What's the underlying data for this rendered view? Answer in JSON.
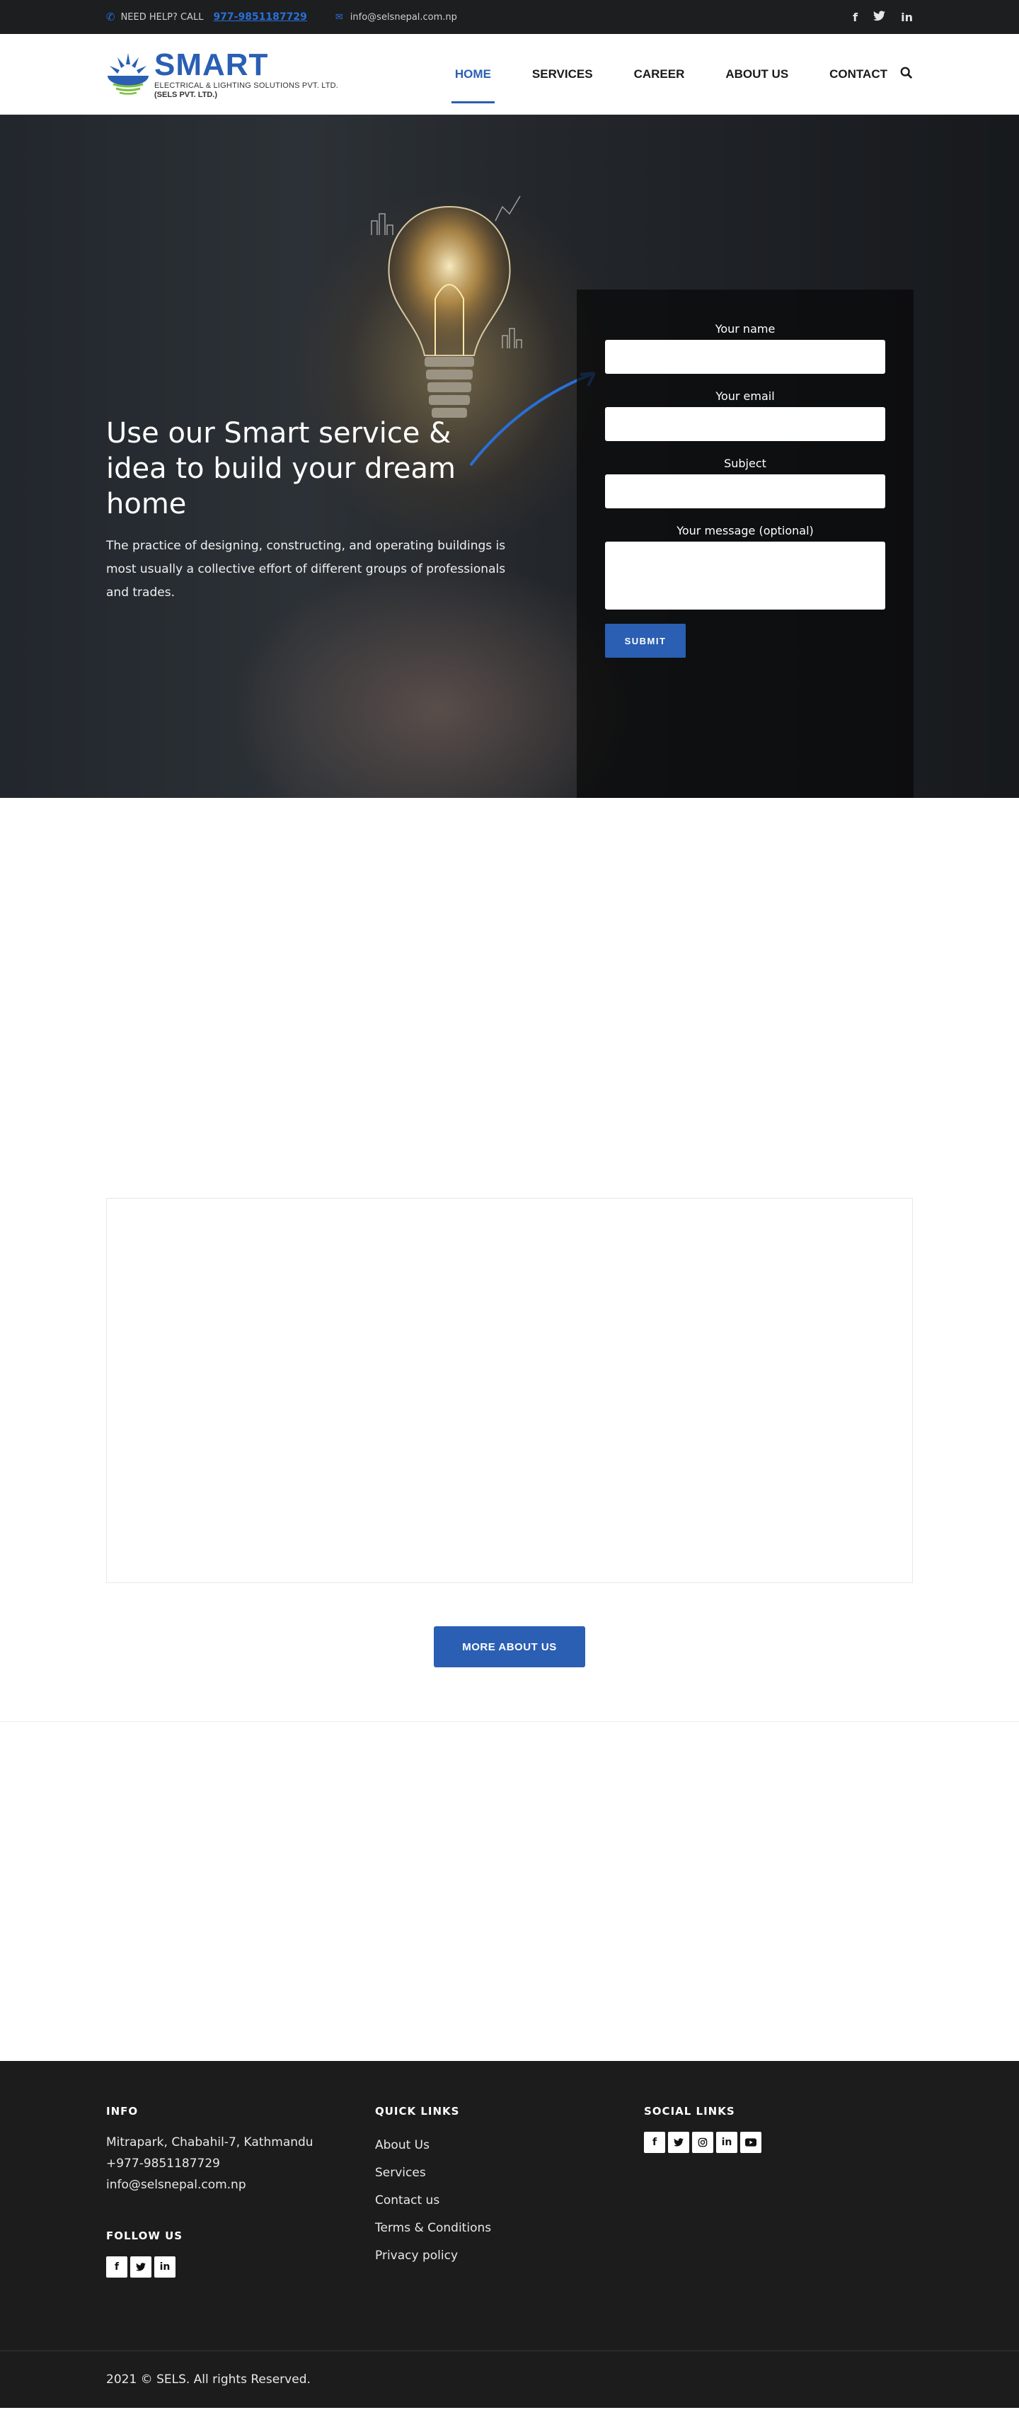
{
  "topbar": {
    "help_text": "NEED HELP? CALL",
    "phone": "977-9851187729",
    "email": "info@selsnepal.com.np",
    "socials": [
      "facebook-icon",
      "twitter-icon",
      "linkedin-icon"
    ]
  },
  "logo": {
    "brand": "SMART",
    "subtitle": "ELECTRICAL & LIGHTING SOLUTIONS PVT. LTD.",
    "subtitle2": "(SELS PVT. LTD.)"
  },
  "nav": {
    "items": [
      {
        "label": "HOME",
        "active": true
      },
      {
        "label": "SERVICES",
        "active": false
      },
      {
        "label": "CAREER",
        "active": false
      },
      {
        "label": "ABOUT US",
        "active": false
      },
      {
        "label": "CONTACT",
        "active": false
      }
    ]
  },
  "hero": {
    "title": "Use our Smart service & idea to build your dream home",
    "description": "The practice of designing, constructing, and operating buildings is most usually a collective effort of different groups of professionals and trades."
  },
  "form": {
    "name_label": "Your name",
    "email_label": "Your email",
    "subject_label": "Subject",
    "message_label": "Your message (optional)",
    "submit_label": "SUBMIT"
  },
  "about": {
    "more_label": "MORE ABOUT US"
  },
  "footer": {
    "info_heading": "INFO",
    "address": "Mitrapark, Chabahil-7, Kathmandu",
    "phone": "+977-9851187729",
    "email": "info@selsnepal.com.np",
    "follow_heading": "FOLLOW US",
    "quick_heading": "QUICK LINKS",
    "links": [
      "About Us",
      "Services",
      "Contact us",
      "Terms & Conditions",
      "Privacy policy"
    ],
    "social_heading": "SOCIAL LINKS",
    "copyright": "2021 © SELS. All rights Reserved."
  },
  "colors": {
    "accent": "#2a5fb3",
    "topbar_bg": "#1c1e20",
    "footer_bg": "#1c1c1c"
  }
}
